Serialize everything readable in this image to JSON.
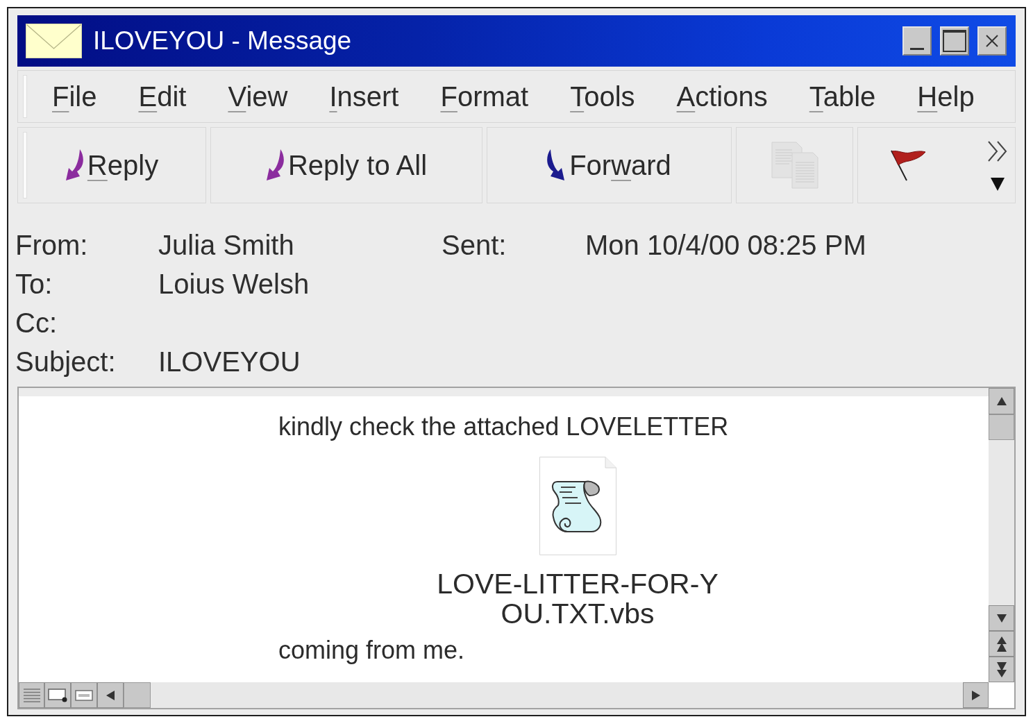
{
  "window": {
    "title": "ILOVEYOU - Message"
  },
  "menu": [
    {
      "label": [
        {
          "text": "F",
          "access_key": true
        },
        {
          "text": "ile",
          "access_key": false
        }
      ]
    },
    {
      "label": [
        {
          "text": "E",
          "access_key": true
        },
        {
          "text": "dit",
          "access_key": false
        }
      ]
    },
    {
      "label": [
        {
          "text": "V",
          "access_key": true
        },
        {
          "text": "iew",
          "access_key": false
        }
      ]
    },
    {
      "label": [
        {
          "text": "I",
          "access_key": true
        },
        {
          "text": "nsert",
          "access_key": false
        }
      ]
    },
    {
      "label": [
        {
          "text": "F",
          "access_key": true
        },
        {
          "text": "ormat",
          "access_key": false
        }
      ]
    },
    {
      "label": [
        {
          "text": "T",
          "access_key": true
        },
        {
          "text": "ools",
          "access_key": false
        }
      ]
    },
    {
      "label": [
        {
          "text": "A",
          "access_key": true
        },
        {
          "text": "ctions",
          "access_key": false
        }
      ]
    },
    {
      "label": [
        {
          "text": "T",
          "access_key": true
        },
        {
          "text": "able",
          "access_key": false
        }
      ]
    },
    {
      "label": [
        {
          "text": "H",
          "access_key": true
        },
        {
          "text": "elp",
          "access_key": false
        }
      ]
    }
  ],
  "toolbar": [
    {
      "label": [
        {
          "text": "R",
          "access_key": true
        },
        {
          "text": "eply",
          "access_key": false
        }
      ],
      "disabled": false
    },
    {
      "label": [
        {
          "text": "Reply to All",
          "access_key": false
        }
      ],
      "disabled": false
    },
    {
      "label": [
        {
          "text": "For",
          "access_key": false
        },
        {
          "text": "w",
          "access_key": true
        },
        {
          "text": "ard",
          "access_key": false
        }
      ],
      "disabled": false
    },
    {
      "disabled": true
    },
    {
      "disabled": false
    }
  ],
  "header_rows": [
    {
      "fields": [
        {
          "label": "From:",
          "value": "Julia Smith"
        },
        {
          "label": "Sent:",
          "value": "Mon 10/4/00 08:25 PM"
        }
      ]
    },
    {
      "fields": [
        {
          "label": "To:",
          "value": "Loius Welsh"
        }
      ]
    },
    {
      "fields": [
        {
          "label": "Cc:"
        }
      ]
    },
    {
      "fields": [
        {
          "label": "Subject:",
          "value": "ILOVEYOU"
        }
      ]
    }
  ],
  "body": [
    {
      "kind": "text",
      "text": "kindly check the attached LOVELETTER"
    },
    {
      "kind": "attachment",
      "file_name": "LOVE-LITTER-FOR-YOU.TXT.vbs"
    },
    {
      "kind": "text",
      "text": "coming from me."
    }
  ]
}
